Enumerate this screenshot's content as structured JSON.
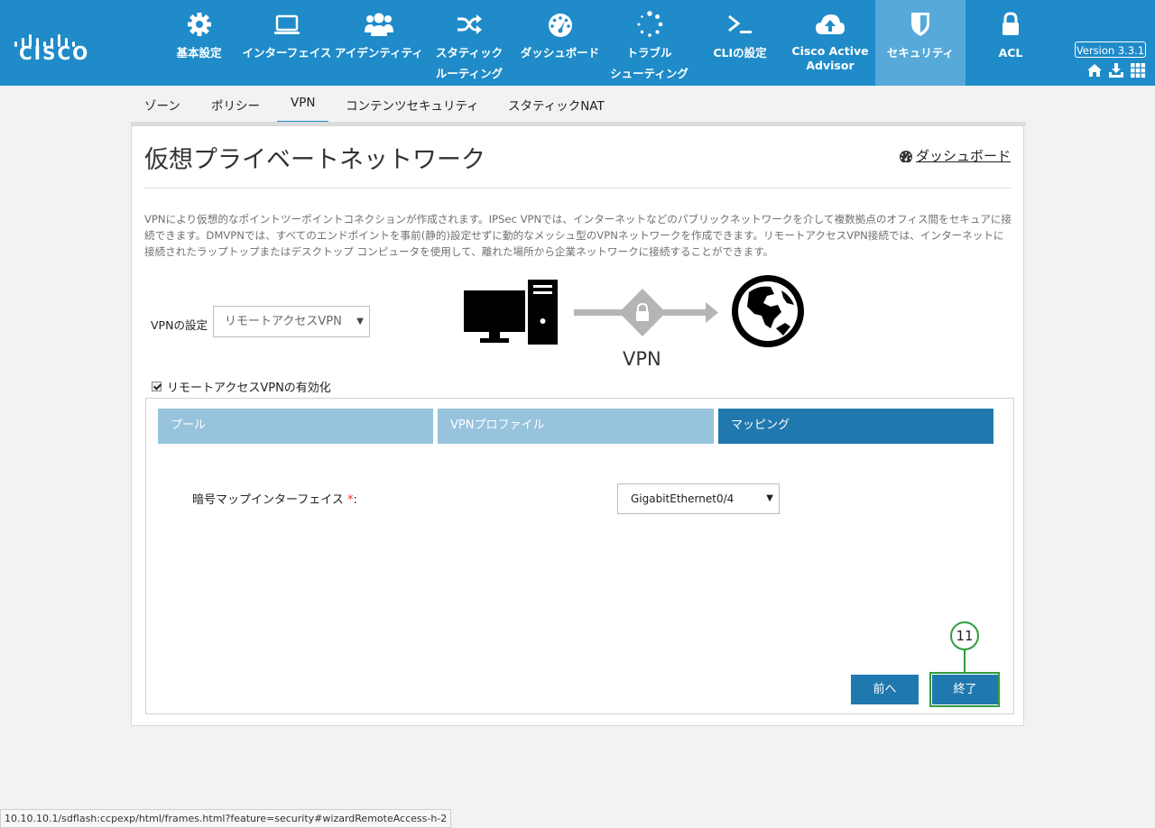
{
  "brand": {
    "logo_text": "CISCO"
  },
  "nav": {
    "items": [
      {
        "label": "基本設定",
        "icon": "gear-icon"
      },
      {
        "label": "インターフェイス",
        "icon": "monitor-icon"
      },
      {
        "label": "アイデンティティ",
        "icon": "users-icon"
      },
      {
        "label": "スタティック\nルーティング",
        "icon": "shuffle-icon"
      },
      {
        "label": "ダッシュボード",
        "icon": "dashboard-icon"
      },
      {
        "label": "トラブル\nシューティング",
        "icon": "spinner-icon"
      },
      {
        "label": "CLIの設定",
        "icon": "terminal-icon"
      },
      {
        "label": "Cisco Active\nAdvisor",
        "icon": "cloud-upload-icon"
      },
      {
        "label": "セキュリティ",
        "icon": "shield-icon",
        "active": true
      },
      {
        "label": "ACL",
        "icon": "lock-icon"
      }
    ],
    "version": "Version 3.3.1",
    "tools": [
      "home-icon",
      "download-icon",
      "grid-icon"
    ]
  },
  "subtabs": [
    {
      "label": "ゾーン"
    },
    {
      "label": "ポリシー"
    },
    {
      "label": "VPN",
      "active": true
    },
    {
      "label": "コンテンツセキュリティ"
    },
    {
      "label": "スタティックNAT"
    }
  ],
  "page": {
    "title": "仮想プライベートネットワーク",
    "dashboard_link": "ダッシュボード",
    "description": "VPNにより仮想的なポイントツーポイントコネクションが作成されます。IPSec VPNでは、インターネットなどのパブリックネットワークを介して複数拠点のオフィス間をセキュアに接続できます。DMVPNでは、すべてのエンドポイントを事前(静的)設定せずに動的なメッシュ型のVPNネットワークを作成できます。リモートアクセスVPN接続では、インターネットに接続されたラップトップまたはデスクトップ コンピュータを使用して、離れた場所から企業ネットワークに接続することができます。",
    "vpn_setting_label": "VPNの設定",
    "vpn_setting_value": "リモートアクセスVPN",
    "diagram_caption": "VPN",
    "enable_label": "リモートアクセスVPNの有効化",
    "enable_checked": true
  },
  "wizard": {
    "tabs": [
      {
        "label": "プール"
      },
      {
        "label": "VPNプロファイル"
      },
      {
        "label": "マッピング",
        "active": true
      }
    ],
    "field_label": "暗号マップインターフェイス",
    "required_mark": "*",
    "field_colon": ":",
    "field_value": "GigabitEthernet0/4",
    "prev_button": "前へ",
    "finish_button": "終了",
    "step_marker": "11"
  },
  "statusbar": {
    "url": "10.10.10.1/sdflash:ccpexp/html/frames.html?feature=security#wizardRemoteAccess-h-2"
  },
  "colors": {
    "topbar": "#1f8bc9",
    "active_tab": "#2079ae",
    "inactive_tab": "#97c3dd",
    "highlight": "#2e9e3e"
  }
}
